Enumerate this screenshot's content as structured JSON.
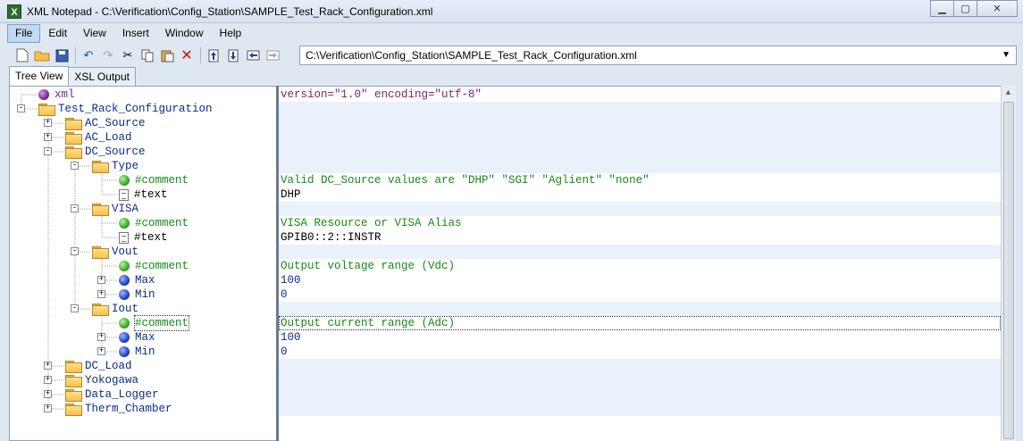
{
  "window": {
    "title": "XML Notepad - C:\\Verification\\Config_Station\\SAMPLE_Test_Rack_Configuration.xml",
    "app_icon": "X"
  },
  "menu": [
    "File",
    "Edit",
    "View",
    "Insert",
    "Window",
    "Help"
  ],
  "toolbar": {
    "path": "C:\\Verification\\Config_Station\\SAMPLE_Test_Rack_Configuration.xml",
    "icons": [
      "new-icon",
      "open-icon",
      "save-icon",
      "undo-icon",
      "redo-icon",
      "cut-icon",
      "copy-icon",
      "paste-icon",
      "delete-icon",
      "nudge-up-icon",
      "nudge-down-icon",
      "nudge-left-icon",
      "nudge-right-icon"
    ]
  },
  "tabs": [
    "Tree View",
    "XSL Output"
  ],
  "tree": [
    {
      "label": "xml",
      "kind": "pi",
      "level": 0,
      "expander": ""
    },
    {
      "label": "Test_Rack_Configuration",
      "kind": "folder",
      "level": 0,
      "expander": "−"
    },
    {
      "label": "AC_Source",
      "kind": "folder",
      "level": 1,
      "expander": "+"
    },
    {
      "label": "AC_Load",
      "kind": "folder",
      "level": 1,
      "expander": "+"
    },
    {
      "label": "DC_Source",
      "kind": "folder",
      "level": 1,
      "expander": "−"
    },
    {
      "label": "Type",
      "kind": "folder",
      "level": 2,
      "expander": "−"
    },
    {
      "label": "#comment",
      "kind": "comment",
      "level": 3,
      "expander": ""
    },
    {
      "label": "#text",
      "kind": "text",
      "level": 3,
      "expander": ""
    },
    {
      "label": "VISA",
      "kind": "folder",
      "level": 2,
      "expander": "−"
    },
    {
      "label": "#comment",
      "kind": "comment",
      "level": 3,
      "expander": ""
    },
    {
      "label": "#text",
      "kind": "text",
      "level": 3,
      "expander": ""
    },
    {
      "label": "Vout",
      "kind": "folder",
      "level": 2,
      "expander": "−"
    },
    {
      "label": "#comment",
      "kind": "comment",
      "level": 3,
      "expander": ""
    },
    {
      "label": "Max",
      "kind": "leaf",
      "level": 3,
      "expander": "+"
    },
    {
      "label": "Min",
      "kind": "leaf",
      "level": 3,
      "expander": "+"
    },
    {
      "label": "Iout",
      "kind": "folder",
      "level": 2,
      "expander": "−"
    },
    {
      "label": "#comment",
      "kind": "comment",
      "level": 3,
      "expander": "",
      "focused": true
    },
    {
      "label": "Max",
      "kind": "leaf",
      "level": 3,
      "expander": "+"
    },
    {
      "label": "Min",
      "kind": "leaf",
      "level": 3,
      "expander": "+"
    },
    {
      "label": "DC_Load",
      "kind": "folder",
      "level": 1,
      "expander": "+"
    },
    {
      "label": "Yokogawa",
      "kind": "folder",
      "level": 1,
      "expander": "+"
    },
    {
      "label": "Data_Logger",
      "kind": "folder",
      "level": 1,
      "expander": "+"
    },
    {
      "label": "Therm_Chamber",
      "kind": "folder",
      "level": 1,
      "expander": "+"
    }
  ],
  "values": [
    {
      "text": "version=\"1.0\" encoding=\"utf-8\"",
      "kind": "pi",
      "shaded": false
    },
    {
      "text": "",
      "kind": "text",
      "shaded": true
    },
    {
      "text": "",
      "kind": "text",
      "shaded": true
    },
    {
      "text": "",
      "kind": "text",
      "shaded": true
    },
    {
      "text": "",
      "kind": "text",
      "shaded": true
    },
    {
      "text": "",
      "kind": "text",
      "shaded": true
    },
    {
      "text": "Valid DC_Source values are \"DHP\" \"SGI\" \"Aglient\" \"none\"",
      "kind": "comment",
      "shaded": false
    },
    {
      "text": "DHP",
      "kind": "text",
      "shaded": false
    },
    {
      "text": "",
      "kind": "text",
      "shaded": true
    },
    {
      "text": "VISA Resource or VISA Alias",
      "kind": "comment",
      "shaded": false
    },
    {
      "text": "GPIB0::2::INSTR",
      "kind": "text",
      "shaded": false
    },
    {
      "text": "",
      "kind": "text",
      "shaded": true
    },
    {
      "text": "Output voltage range (Vdc)",
      "kind": "comment",
      "shaded": false
    },
    {
      "text": "100",
      "kind": "blue",
      "shaded": false
    },
    {
      "text": "0",
      "kind": "blue",
      "shaded": false
    },
    {
      "text": "",
      "kind": "text",
      "shaded": true
    },
    {
      "text": "Output current range (Adc)",
      "kind": "comment",
      "shaded": false,
      "focused": true
    },
    {
      "text": "100",
      "kind": "blue",
      "shaded": false
    },
    {
      "text": "0",
      "kind": "blue",
      "shaded": false
    },
    {
      "text": "",
      "kind": "text",
      "shaded": true
    },
    {
      "text": "",
      "kind": "text",
      "shaded": true
    },
    {
      "text": "",
      "kind": "text",
      "shaded": true
    },
    {
      "text": "",
      "kind": "text",
      "shaded": true
    }
  ]
}
